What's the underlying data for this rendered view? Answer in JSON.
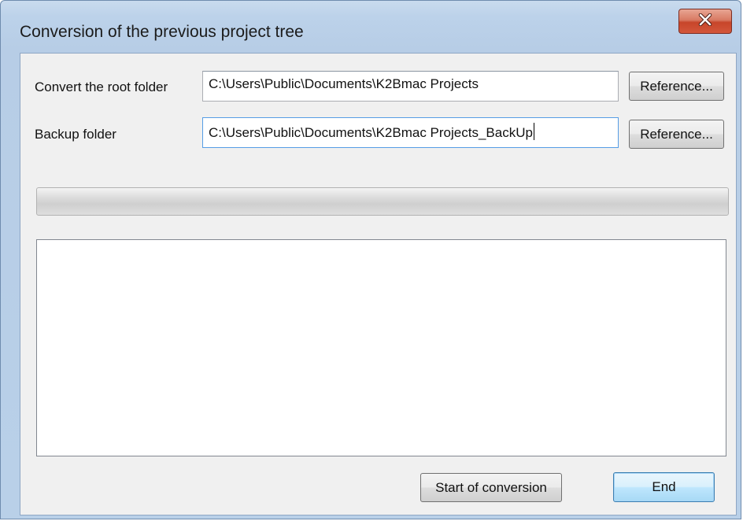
{
  "window": {
    "title": "Conversion of the previous project tree",
    "close_icon": "close-icon"
  },
  "form": {
    "root_label": "Convert the root folder",
    "root_value": "C:\\Users\\Public\\Documents\\K2Bmac Projects",
    "backup_label": "Backup folder",
    "backup_value": "C:\\Users\\Public\\Documents\\K2Bmac Projects_BackUp",
    "reference_label": "Reference..."
  },
  "progress": {
    "value": 0
  },
  "log": {
    "text": ""
  },
  "buttons": {
    "start_label": "Start of conversion",
    "end_label": "End"
  },
  "colors": {
    "frame": "#b9d0e8",
    "close": "#c7452a",
    "default_button": "#bee6fd"
  }
}
